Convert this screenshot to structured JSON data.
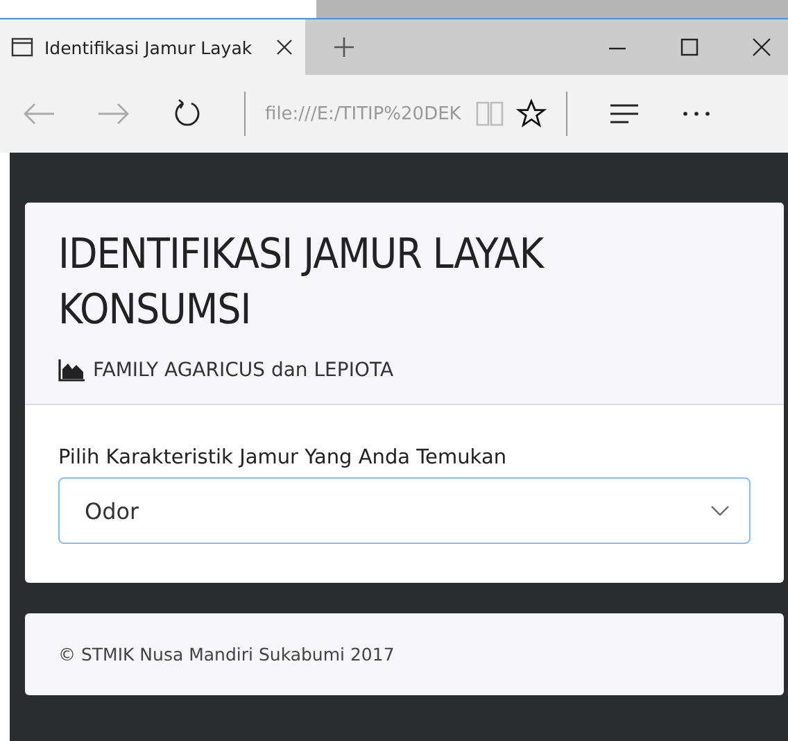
{
  "browser": {
    "tab_title": "Identifikasi Jamur Layak",
    "address": "file:///E:/TITIP%20DEK"
  },
  "card": {
    "title": "IDENTIFIKASI JAMUR LAYAK KONSUMSI",
    "subtitle": "FAMILY AGARICUS dan LEPIOTA",
    "label": "Pilih Karakteristik Jamur Yang Anda Temukan",
    "select_value": "Odor"
  },
  "footer": {
    "text": "© STMIK Nusa Mandiri Sukabumi 2017"
  }
}
